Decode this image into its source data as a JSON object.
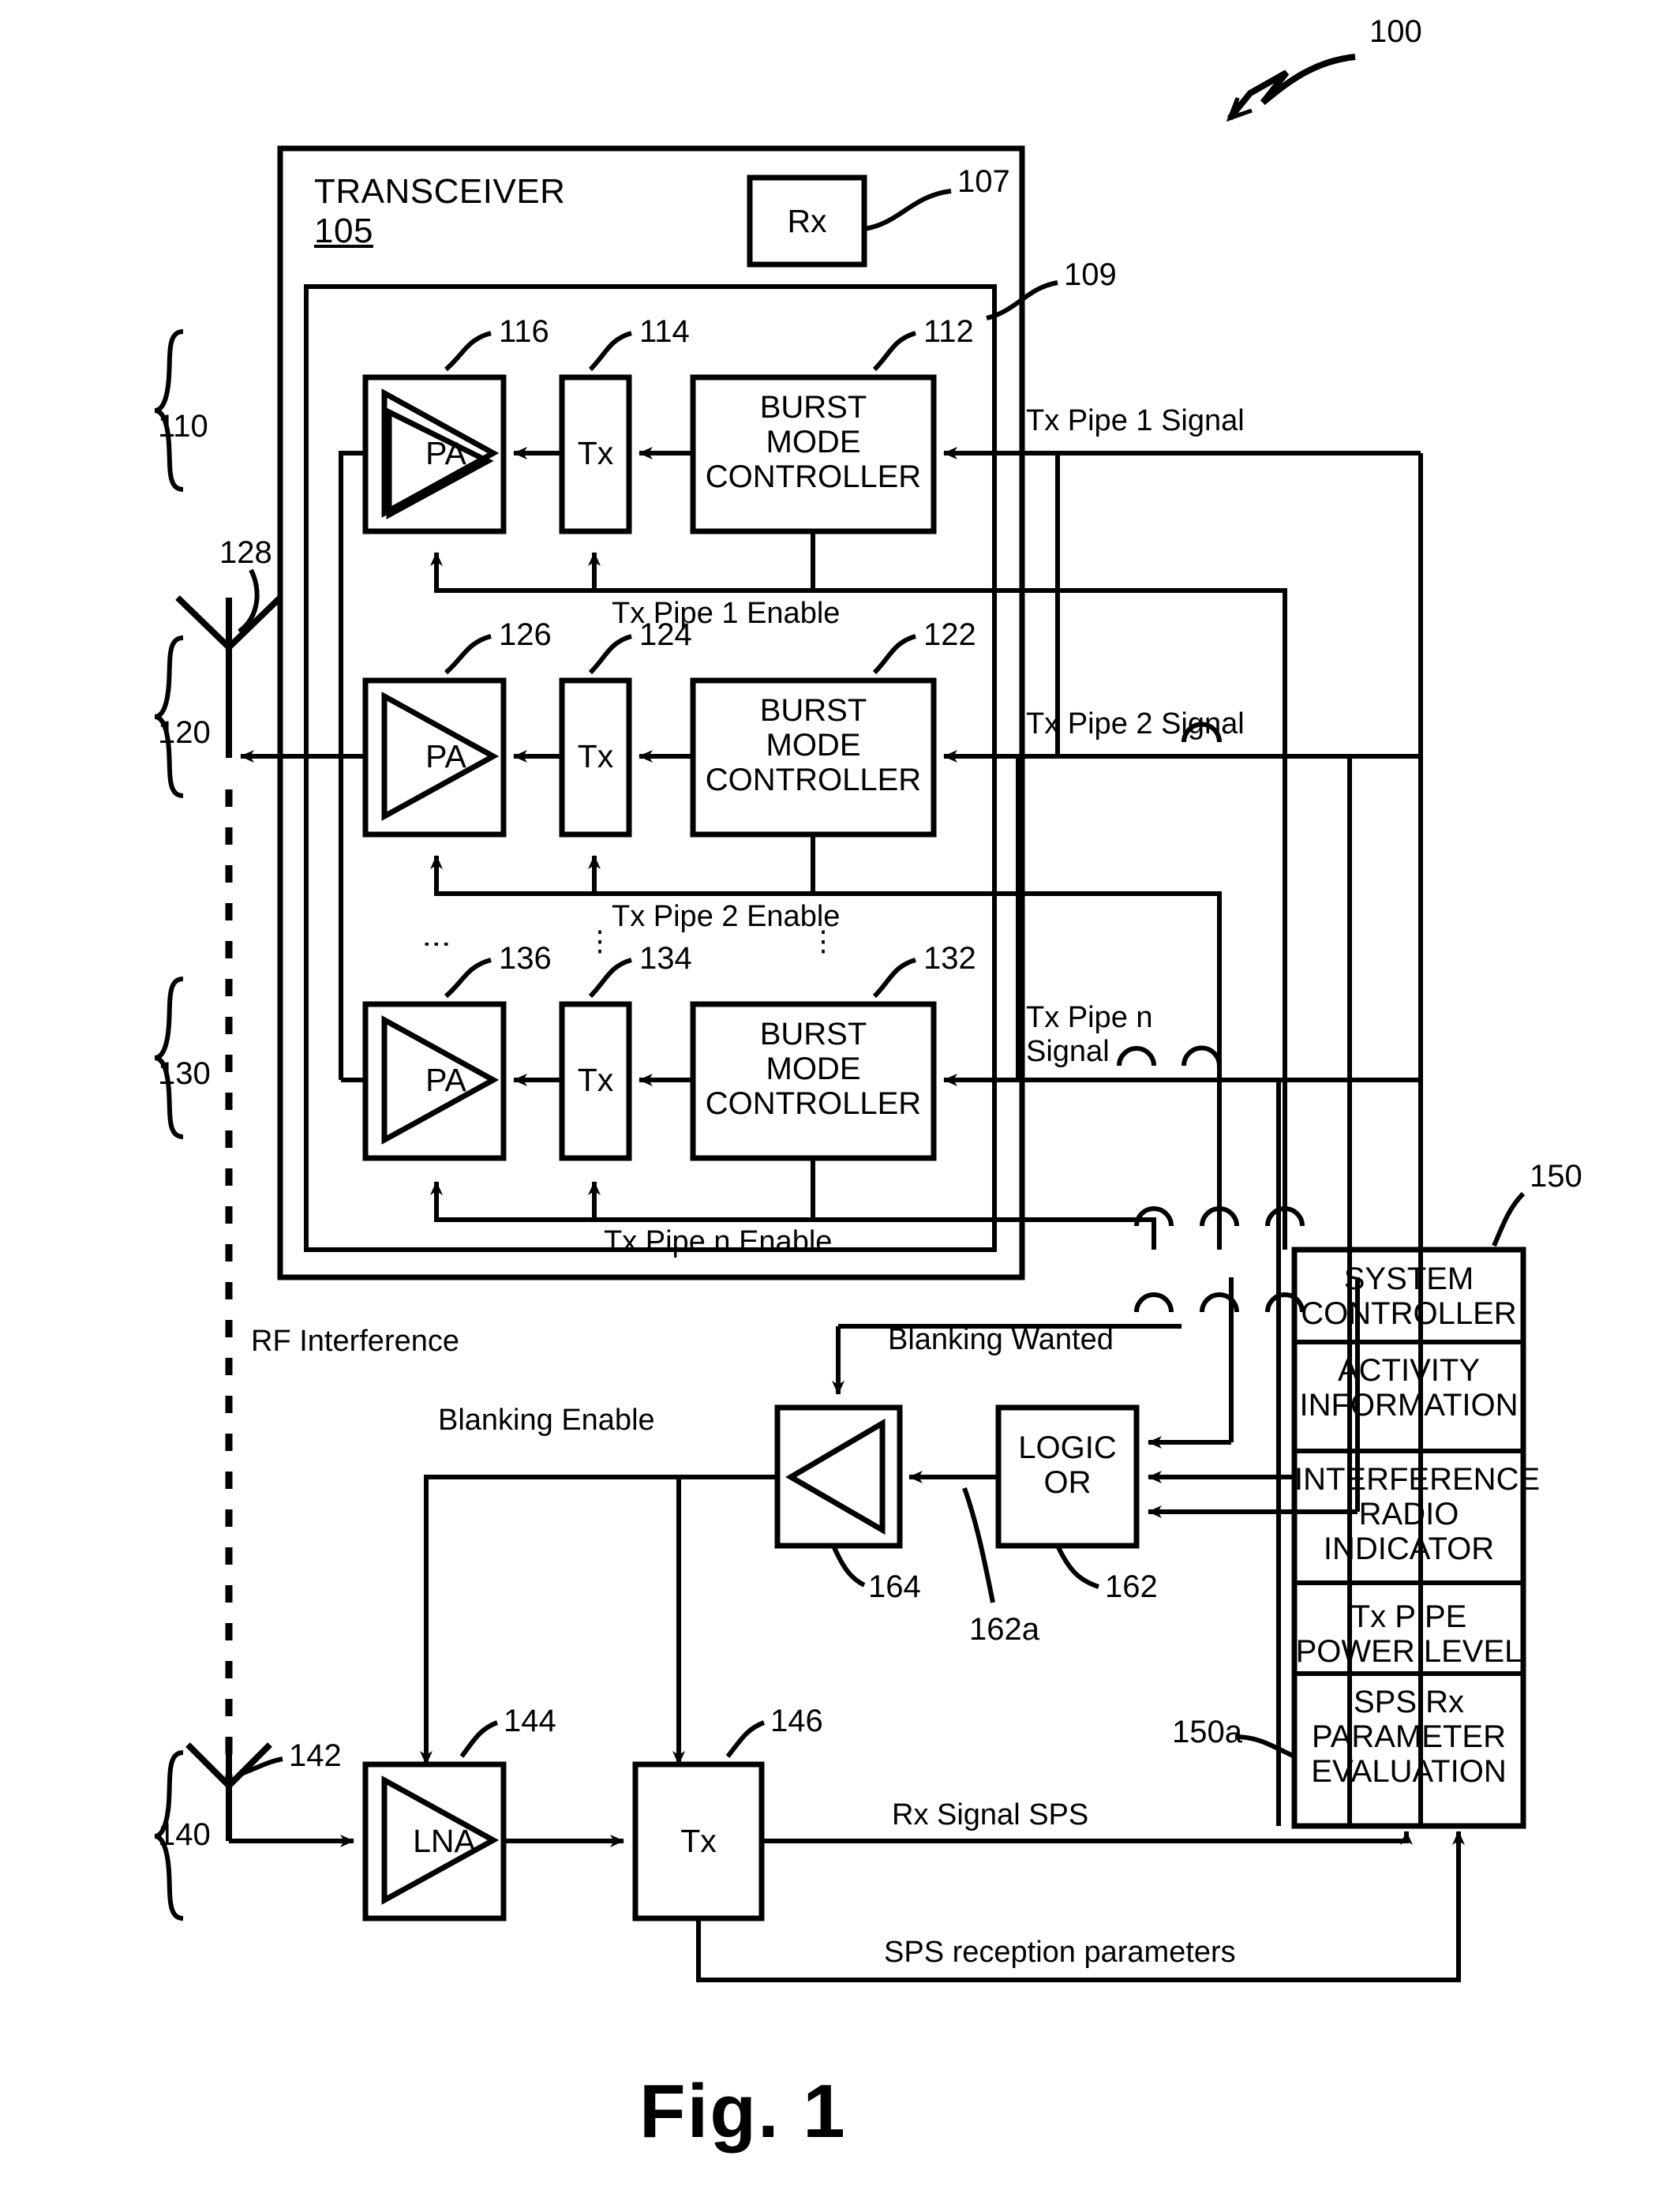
{
  "figure": {
    "caption": "Fig. 1",
    "system_ref": "100"
  },
  "transceiver": {
    "title": "TRANSCEIVER",
    "ref": "105",
    "inner_ref": "109",
    "rx_block": {
      "label": "Rx",
      "ref": "107"
    }
  },
  "tx_pipes": [
    {
      "group_ref": "110",
      "pa": {
        "label": "PA",
        "ref": "116"
      },
      "tx": {
        "label": "Tx",
        "ref": "114"
      },
      "controller": {
        "label": "BURST\nMODE\nCONTROLLER",
        "ref": "112"
      },
      "signal_label": "Tx Pipe 1 Signal",
      "enable_label": "Tx Pipe 1 Enable"
    },
    {
      "group_ref": "120",
      "pa": {
        "label": "PA",
        "ref": "126"
      },
      "tx": {
        "label": "Tx",
        "ref": "124"
      },
      "controller": {
        "label": "BURST\nMODE\nCONTROLLER",
        "ref": "122"
      },
      "signal_label": "Tx Pipe 2 Signal",
      "enable_label": "Tx Pipe 2 Enable"
    },
    {
      "group_ref": "130",
      "pa": {
        "label": "PA",
        "ref": "136"
      },
      "tx": {
        "label": "Tx",
        "ref": "134"
      },
      "controller": {
        "label": "BURST\nMODE\nCONTROLLER",
        "ref": "132"
      },
      "signal_label": "Tx Pipe n\nSignal",
      "enable_label": "Tx Pipe n Enable"
    }
  ],
  "tx_antenna": {
    "ref": "128"
  },
  "interference_label": "RF Interference",
  "blanking": {
    "wanted_label": "Blanking Wanted",
    "enable_label": "Blanking Enable",
    "amplifier_ref": "164",
    "logic_block": {
      "label": "LOGIC\nOR",
      "ref": "162"
    },
    "logic_out_ref": "162a"
  },
  "sps_receiver": {
    "group_ref": "140",
    "antenna_ref": "142",
    "lna": {
      "label": "LNA",
      "ref": "144"
    },
    "tx": {
      "label": "Tx",
      "ref": "146"
    },
    "rx_signal_label": "Rx Signal SPS",
    "params_label": "SPS reception parameters"
  },
  "system_controller": {
    "ref": "150",
    "sub_ref": "150a",
    "rows": [
      "SYSTEM\nCONTROLLER",
      "ACTIVITY\nINFORMATION",
      "INTERFERENCE\nRADIO\nINDICATOR",
      "Tx PIPE\nPOWER LEVEL",
      "SPS Rx\nPARAMETER\nEVALUATION"
    ]
  },
  "ellipsis": {
    "glyph": "•"
  }
}
